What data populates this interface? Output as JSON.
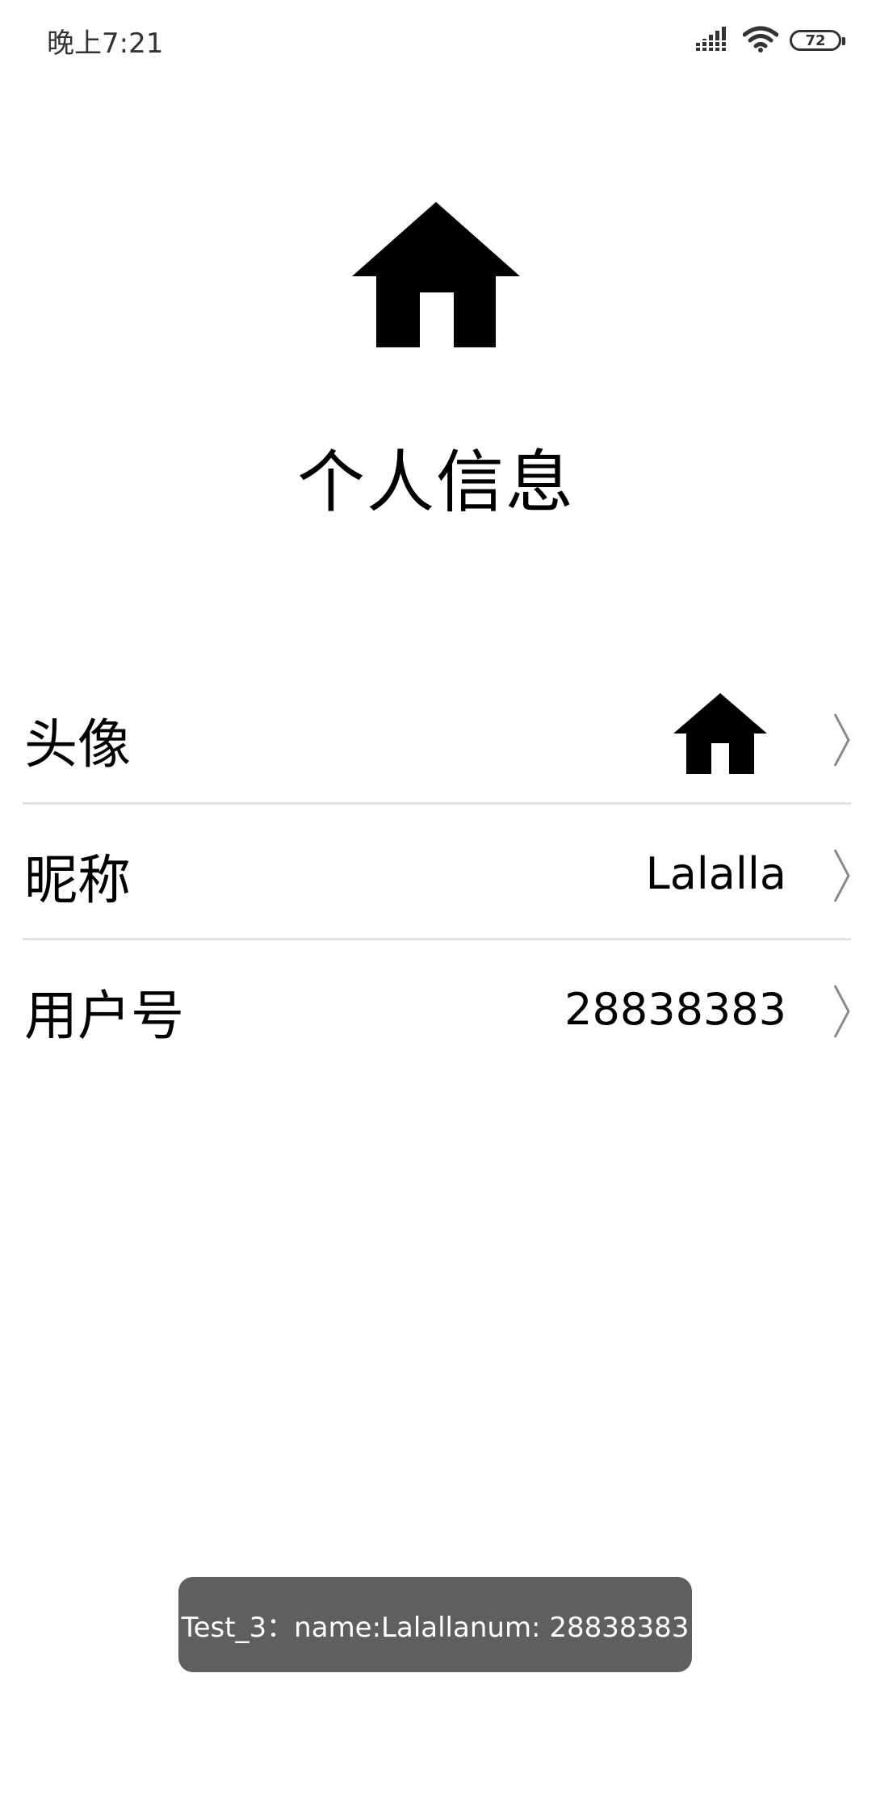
{
  "status_bar": {
    "time": "晚上7:21",
    "battery_level": "72",
    "icons": [
      "signal-icon",
      "wifi-icon",
      "battery-icon"
    ]
  },
  "header": {
    "icon": "home-icon",
    "title": "个人信息"
  },
  "profile_rows": [
    {
      "label": "头像",
      "value_icon": "home-icon",
      "chevron": "chevron-right-icon"
    },
    {
      "label": "昵称",
      "value": "Lalalla",
      "chevron": "chevron-right-icon"
    },
    {
      "label": "用户号",
      "value": "28838383",
      "chevron": "chevron-right-icon"
    }
  ],
  "toast": {
    "text": "Test_3：name:Lalallanum: 28838383"
  },
  "colors": {
    "background": "#ffffff",
    "divider": "#e2e2e2",
    "toast_background": "#5f5f5f",
    "chevron": "#8a8a8a"
  }
}
